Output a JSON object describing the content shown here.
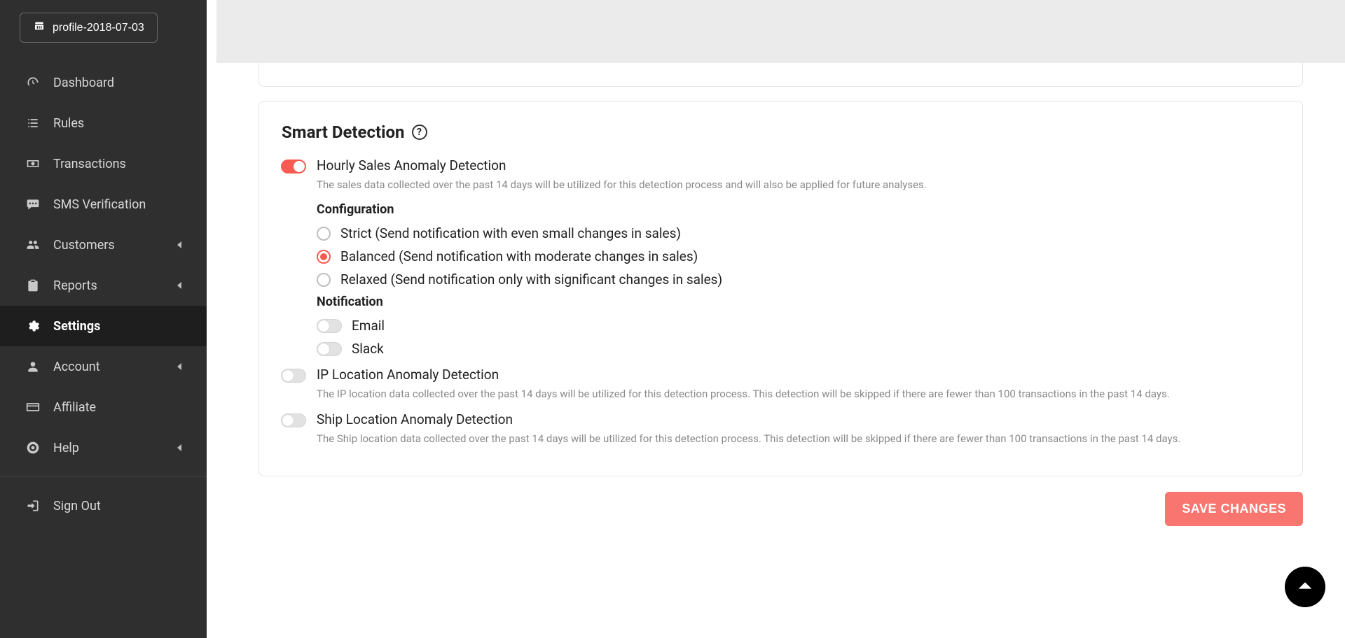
{
  "profile_button": {
    "label": "profile-2018-07-03"
  },
  "sidebar": {
    "items": [
      {
        "key": "dashboard",
        "label": "Dashboard",
        "icon": "gauge",
        "caret": false
      },
      {
        "key": "rules",
        "label": "Rules",
        "icon": "list",
        "caret": false
      },
      {
        "key": "transactions",
        "label": "Transactions",
        "icon": "money",
        "caret": false
      },
      {
        "key": "sms",
        "label": "SMS Verification",
        "icon": "sms",
        "caret": false
      },
      {
        "key": "customers",
        "label": "Customers",
        "icon": "people",
        "caret": true
      },
      {
        "key": "reports",
        "label": "Reports",
        "icon": "clipboard",
        "caret": true
      },
      {
        "key": "settings",
        "label": "Settings",
        "icon": "gears",
        "caret": false,
        "active": true
      },
      {
        "key": "account",
        "label": "Account",
        "icon": "person",
        "caret": true
      },
      {
        "key": "affiliate",
        "label": "Affiliate",
        "icon": "card",
        "caret": false
      },
      {
        "key": "help",
        "label": "Help",
        "icon": "lifebuoy",
        "caret": true
      }
    ],
    "signout_label": "Sign Out"
  },
  "smart_detection": {
    "title": "Smart Detection",
    "hourly": {
      "title": "Hourly Sales Anomaly Detection",
      "enabled": true,
      "desc": "The sales data collected over the past 14 days will be utilized for this detection process and will also be applied for future analyses.",
      "config_heading": "Configuration",
      "options": {
        "strict": "Strict (Send notification with even small changes in sales)",
        "balanced": "Balanced (Send notification with moderate changes in sales)",
        "relaxed": "Relaxed (Send notification only with significant changes in sales)"
      },
      "selected": "balanced",
      "notif_heading": "Notification",
      "notif_email": {
        "label": "Email",
        "enabled": false
      },
      "notif_slack": {
        "label": "Slack",
        "enabled": false
      }
    },
    "ip": {
      "title": "IP Location Anomaly Detection",
      "enabled": false,
      "desc": "The IP location data collected over the past 14 days will be utilized for this detection process. This detection will be skipped if there are fewer than 100 transactions in the past 14 days."
    },
    "ship": {
      "title": "Ship Location Anomaly Detection",
      "enabled": false,
      "desc": "The Ship location data collected over the past 14 days will be utilized for this detection process. This detection will be skipped if there are fewer than 100 transactions in the past 14 days."
    }
  },
  "buttons": {
    "save": "SAVE CHANGES"
  }
}
